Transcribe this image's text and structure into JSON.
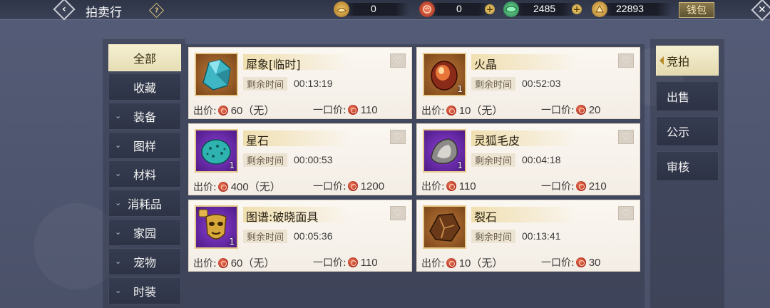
{
  "header": {
    "title": "拍卖行",
    "help_icon": "question-diamond-icon",
    "currencies": [
      {
        "name": "gold-ingot",
        "value": "0",
        "color": "#d9a441"
      },
      {
        "name": "red-token",
        "value": "0",
        "color": "#c8452c"
      },
      {
        "name": "jade",
        "value": "2485",
        "color": "#3fae6a"
      },
      {
        "name": "coin",
        "value": "22893",
        "color": "#d9a441"
      }
    ],
    "wallet_label": "钱包"
  },
  "categories": [
    {
      "label": "全部",
      "active": true,
      "expandable": false
    },
    {
      "label": "收藏",
      "active": false,
      "expandable": false
    },
    {
      "label": "装备",
      "active": false,
      "expandable": true
    },
    {
      "label": "图样",
      "active": false,
      "expandable": true
    },
    {
      "label": "材料",
      "active": false,
      "expandable": true
    },
    {
      "label": "消耗品",
      "active": false,
      "expandable": true
    },
    {
      "label": "家园",
      "active": false,
      "expandable": true
    },
    {
      "label": "宠物",
      "active": false,
      "expandable": true
    },
    {
      "label": "时装",
      "active": false,
      "expandable": true
    }
  ],
  "listing": {
    "time_label": "剩余时间",
    "bid_label": "出价:",
    "buyout_label": "一口价:",
    "items": [
      {
        "name": "犀象[临时]",
        "time": "00:13:19",
        "bid": "60（无）",
        "buyout": "110",
        "qty": "",
        "frame": "orange",
        "art": "teal-crystal"
      },
      {
        "name": "火晶",
        "time": "00:52:03",
        "bid": "10（无）",
        "buyout": "20",
        "qty": "1",
        "frame": "orange",
        "art": "fire-crystal"
      },
      {
        "name": "星石",
        "time": "00:00:53",
        "bid": "400（无）",
        "buyout": "1200",
        "qty": "1",
        "frame": "purple",
        "art": "star-stone"
      },
      {
        "name": "灵狐毛皮",
        "time": "00:04:18",
        "bid": "110",
        "buyout": "210",
        "qty": "1",
        "frame": "purple",
        "art": "fox-fur"
      },
      {
        "name": "图谱:破晓面具",
        "time": "00:05:36",
        "bid": "60（无）",
        "buyout": "110",
        "qty": "1",
        "frame": "purple",
        "art": "golden-mask"
      },
      {
        "name": "裂石",
        "time": "00:13:41",
        "bid": "10（无）",
        "buyout": "30",
        "qty": "",
        "frame": "orange",
        "art": "cracked-stone"
      }
    ]
  },
  "tabs": [
    {
      "label": "竞拍",
      "active": true
    },
    {
      "label": "出售",
      "active": false
    },
    {
      "label": "公示",
      "active": false
    },
    {
      "label": "审核",
      "active": false
    }
  ]
}
